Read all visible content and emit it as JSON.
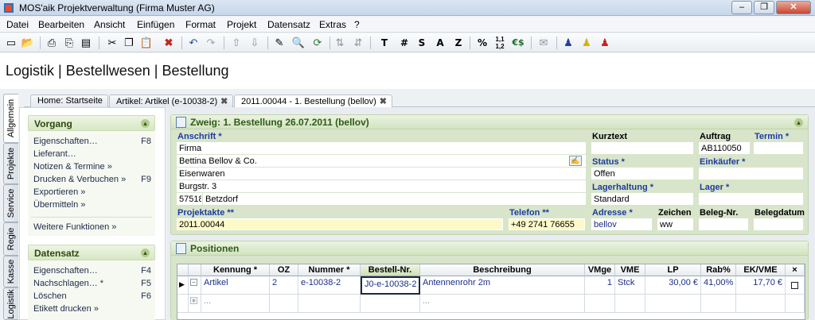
{
  "window": {
    "title": "MOS'aik Projektverwaltung (Firma Muster AG)",
    "min": "–",
    "max": "❐",
    "close": "✕"
  },
  "menu": [
    "Datei",
    "Bearbeiten",
    "Ansicht",
    "Einfügen",
    "Format",
    "Projekt",
    "Datensatz",
    "Extras",
    "?"
  ],
  "toolbar": {
    "text_buttons": [
      "T",
      "#",
      "S",
      "A",
      "Z",
      "%",
      "€$"
    ]
  },
  "page_title": "Logistik | Bestellwesen | Bestellung",
  "vertical_tabs": [
    "Allgemein",
    "Projekte",
    "Service",
    "Regie",
    "Kasse",
    "Logistik"
  ],
  "tabs": [
    {
      "label": "Home: Startseite"
    },
    {
      "label": "Artikel: Artikel (e-10038-2)",
      "close": "✖"
    },
    {
      "label": "2011.00044 - 1. Bestellung (bellov)",
      "close": "✖"
    }
  ],
  "left_panel": {
    "vorgang": {
      "title": "Vorgang",
      "items": [
        {
          "label": "Eigenschaften…",
          "key": "F8"
        },
        {
          "label": "Lieferant…",
          "key": ""
        },
        {
          "label": "Notizen & Termine »",
          "key": ""
        },
        {
          "label": "Drucken & Verbuchen »",
          "key": "F9"
        },
        {
          "label": "Exportieren »",
          "key": ""
        },
        {
          "label": "Übermitteln »",
          "key": ""
        }
      ],
      "more": "Weitere Funktionen »"
    },
    "datensatz": {
      "title": "Datensatz",
      "items": [
        {
          "label": "Eigenschaften…",
          "key": "F4"
        },
        {
          "label": "Nachschlagen… *",
          "key": "F5"
        },
        {
          "label": "Löschen",
          "key": "F6"
        },
        {
          "label": "Etikett drucken »",
          "key": ""
        }
      ]
    }
  },
  "zweig": {
    "title": "Zweig: 1. Bestellung 26.07.2011 (bellov)",
    "anschrift_label": "Anschrift *",
    "anschrift_lines": [
      "Firma",
      "Bettina Bellov & Co.",
      "Eisenwaren",
      "Burgstr. 3"
    ],
    "plz": "57518",
    "ort": "Betzdorf",
    "kurztext_label": "Kurztext",
    "kurztext": "",
    "auftrag_label": "Auftrag",
    "auftrag": "AB110050",
    "termin_label": "Termin *",
    "termin": "",
    "status_label": "Status *",
    "status": "Offen",
    "einkaeufer_label": "Einkäufer *",
    "einkaeufer": "",
    "lagerhaltung_label": "Lagerhaltung *",
    "lagerhaltung": "Standard",
    "lager_label": "Lager *",
    "lager": "",
    "projektakte_label": "Projektakte **",
    "projektakte": "2011.00044",
    "telefon_label": "Telefon **",
    "telefon": "+49 2741 76655",
    "adresse_label": "Adresse *",
    "adresse": "bellov",
    "zeichen_label": "Zeichen",
    "zeichen": "ww",
    "belegnr_label": "Beleg-Nr.",
    "belegnr": "",
    "belegdatum_label": "Belegdatum",
    "belegdatum": ""
  },
  "positionen": {
    "title": "Positionen",
    "columns": [
      "Kennung *",
      "OZ",
      "Nummer *",
      "Bestell-Nr.",
      "Beschreibung",
      "VMge",
      "VME",
      "LP",
      "Rab%",
      "EK/VME",
      "×"
    ],
    "rows": [
      {
        "kennung": "Artikel",
        "oz": "2",
        "nummer": "e-10038-2",
        "bestellnr": "J0-e-10038-2",
        "beschreibung": "Antennenrohr 2m",
        "vmge": "1",
        "vme": "Stck",
        "lp": "30,00 €",
        "rab": "41,00%",
        "ek": "17,70 €"
      }
    ],
    "new_row_placeholder": "..."
  }
}
